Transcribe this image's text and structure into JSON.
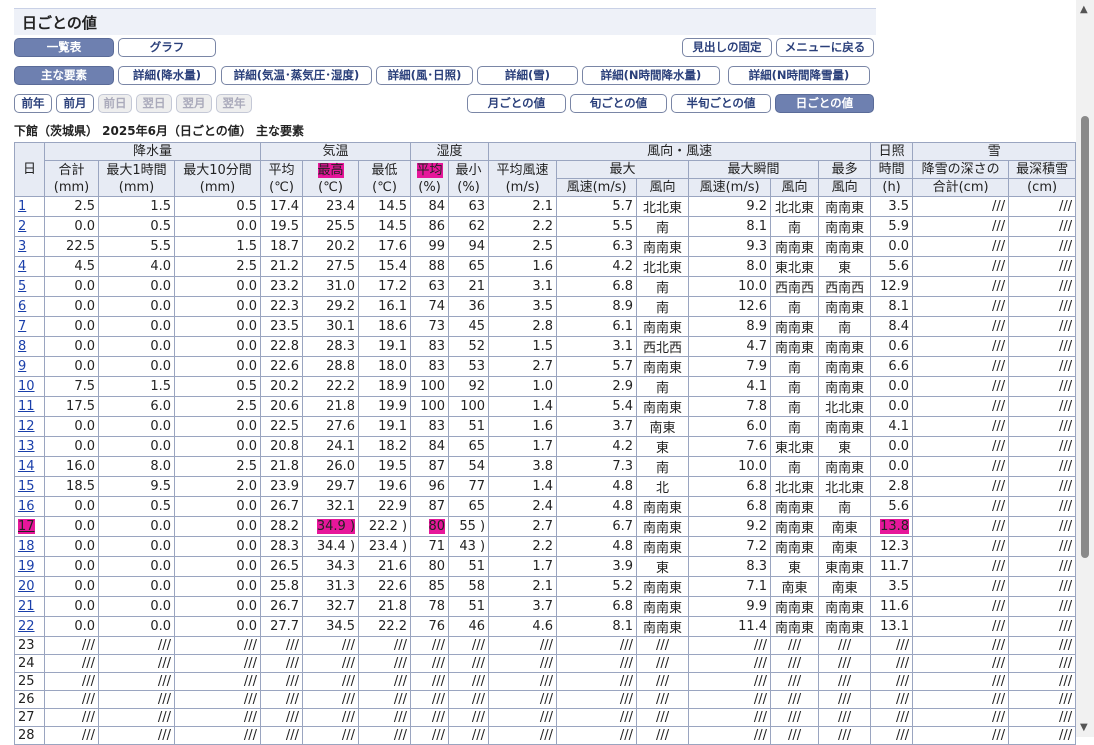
{
  "page_title": "日ごとの値",
  "buttons_row1": {
    "list": "一覧表",
    "graph": "グラフ",
    "fix_header": "見出しの固定",
    "back_menu": "メニューに戻る"
  },
  "tabs_row2": [
    "主な要素",
    "詳細(降水量)",
    "詳細(気温･蒸気圧･湿度)",
    "詳細(風･日照)",
    "詳細(雪)",
    "詳細(N時間降水量)",
    "詳細(N時間降雪量)"
  ],
  "nav_row3": {
    "prev_year": "前年",
    "prev_month": "前月",
    "prev_day": "前日",
    "next_day": "翌日",
    "next_month": "翌月",
    "next_year": "翌年"
  },
  "period_tabs": [
    "月ごとの値",
    "旬ごとの値",
    "半旬ごとの値",
    "日ごとの値"
  ],
  "caption": "下館（茨城県） 2025年6月（日ごとの値） 主な要素",
  "headers": {
    "day": "日",
    "precip": "降水量",
    "temp": "気温",
    "humidity": "湿度",
    "wind": "風向・風速",
    "sunshine": "日照",
    "snow": "雪",
    "total": "合計",
    "max1h": "最大1時間",
    "max10m": "最大10分間",
    "avg": "平均",
    "max": "最高",
    "min": "最低",
    "hum_avg": "平均",
    "hum_min": "最小",
    "wind_avg": "平均風速",
    "wind_max": "最大",
    "wind_gust": "最大瞬間",
    "wind_most": "最多",
    "sun_hours": "時間",
    "snowfall": "降雪の深さの",
    "snowfall2": "合計(cm)",
    "snow_depth": "最深積雪",
    "snow_depth_unit": "(cm)",
    "u_mm": "(mm)",
    "u_c": "(℃)",
    "u_pct": "(%)",
    "u_ms": "(m/s)",
    "speed_ms": "風速(m/s)",
    "dir": "風向",
    "u_h": "(h)"
  },
  "rows": [
    [
      "1",
      "2.5",
      "1.5",
      "0.5",
      "17.4",
      "23.4",
      "14.5",
      "84",
      "63",
      "2.1",
      "5.7",
      "北北東",
      "9.2",
      "北北東",
      "南南東",
      "3.5",
      "///",
      "///"
    ],
    [
      "2",
      "0.0",
      "0.5",
      "0.0",
      "19.5",
      "25.5",
      "14.5",
      "86",
      "62",
      "2.2",
      "5.5",
      "南",
      "8.1",
      "南",
      "南南東",
      "5.9",
      "///",
      "///"
    ],
    [
      "3",
      "22.5",
      "5.5",
      "1.5",
      "18.7",
      "20.2",
      "17.6",
      "99",
      "94",
      "2.5",
      "6.3",
      "南南東",
      "9.3",
      "南南東",
      "南南東",
      "0.0",
      "///",
      "///"
    ],
    [
      "4",
      "4.5",
      "4.0",
      "2.5",
      "21.2",
      "27.5",
      "15.4",
      "88",
      "65",
      "1.6",
      "4.2",
      "北北東",
      "8.0",
      "東北東",
      "東",
      "5.6",
      "///",
      "///"
    ],
    [
      "5",
      "0.0",
      "0.0",
      "0.0",
      "23.2",
      "31.0",
      "17.2",
      "63",
      "21",
      "3.1",
      "6.8",
      "南",
      "10.0",
      "西南西",
      "西南西",
      "12.9",
      "///",
      "///"
    ],
    [
      "6",
      "0.0",
      "0.0",
      "0.0",
      "22.3",
      "29.2",
      "16.1",
      "74",
      "36",
      "3.5",
      "8.9",
      "南",
      "12.6",
      "南",
      "南南東",
      "8.1",
      "///",
      "///"
    ],
    [
      "7",
      "0.0",
      "0.0",
      "0.0",
      "23.5",
      "30.1",
      "18.6",
      "73",
      "45",
      "2.8",
      "6.1",
      "南南東",
      "8.9",
      "南南東",
      "南",
      "8.4",
      "///",
      "///"
    ],
    [
      "8",
      "0.0",
      "0.0",
      "0.0",
      "22.8",
      "28.3",
      "19.1",
      "83",
      "52",
      "1.5",
      "3.1",
      "西北西",
      "4.7",
      "南南東",
      "南南東",
      "0.6",
      "///",
      "///"
    ],
    [
      "9",
      "0.0",
      "0.0",
      "0.0",
      "22.6",
      "28.8",
      "18.0",
      "83",
      "53",
      "2.7",
      "5.7",
      "南南東",
      "7.9",
      "南",
      "南南東",
      "6.6",
      "///",
      "///"
    ],
    [
      "10",
      "7.5",
      "1.5",
      "0.5",
      "20.2",
      "22.2",
      "18.9",
      "100",
      "92",
      "1.0",
      "2.9",
      "南",
      "4.1",
      "南",
      "南南東",
      "0.0",
      "///",
      "///"
    ],
    [
      "11",
      "17.5",
      "6.0",
      "2.5",
      "20.6",
      "21.8",
      "19.9",
      "100",
      "100",
      "1.4",
      "5.4",
      "南南東",
      "7.8",
      "南",
      "北北東",
      "0.0",
      "///",
      "///"
    ],
    [
      "12",
      "0.0",
      "0.0",
      "0.0",
      "22.5",
      "27.6",
      "19.1",
      "83",
      "51",
      "1.6",
      "3.7",
      "南東",
      "6.0",
      "南",
      "南南東",
      "4.1",
      "///",
      "///"
    ],
    [
      "13",
      "0.0",
      "0.0",
      "0.0",
      "20.8",
      "24.1",
      "18.2",
      "84",
      "65",
      "1.7",
      "4.2",
      "東",
      "7.6",
      "東北東",
      "東",
      "0.0",
      "///",
      "///"
    ],
    [
      "14",
      "16.0",
      "8.0",
      "2.5",
      "21.8",
      "26.0",
      "19.5",
      "87",
      "54",
      "3.8",
      "7.3",
      "南",
      "10.0",
      "南",
      "南南東",
      "0.0",
      "///",
      "///"
    ],
    [
      "15",
      "18.5",
      "9.5",
      "2.0",
      "23.9",
      "29.7",
      "19.6",
      "96",
      "77",
      "1.4",
      "4.8",
      "北",
      "6.8",
      "北北東",
      "北北東",
      "2.8",
      "///",
      "///"
    ],
    [
      "16",
      "0.0",
      "0.5",
      "0.0",
      "26.7",
      "32.1",
      "22.9",
      "87",
      "65",
      "2.4",
      "4.8",
      "南南東",
      "6.8",
      "南南東",
      "南",
      "5.6",
      "///",
      "///"
    ],
    [
      "17",
      "0.0",
      "0.0",
      "0.0",
      "28.2",
      "34.9 )",
      "22.2 )",
      "80",
      "55 )",
      "2.7",
      "6.7",
      "南南東",
      "9.2",
      "南南東",
      "南東",
      "13.8",
      "///",
      "///"
    ],
    [
      "18",
      "0.0",
      "0.0",
      "0.0",
      "28.3",
      "34.4 )",
      "23.4 )",
      "71",
      "43 )",
      "2.2",
      "4.8",
      "南南東",
      "7.2",
      "南南東",
      "南東",
      "12.3",
      "///",
      "///"
    ],
    [
      "19",
      "0.0",
      "0.0",
      "0.0",
      "26.5",
      "34.3",
      "21.6",
      "80",
      "51",
      "1.7",
      "3.9",
      "東",
      "8.3",
      "東",
      "東南東",
      "11.7",
      "///",
      "///"
    ],
    [
      "20",
      "0.0",
      "0.0",
      "0.0",
      "25.8",
      "31.3",
      "22.6",
      "85",
      "58",
      "2.1",
      "5.2",
      "南南東",
      "7.1",
      "南東",
      "南東",
      "3.5",
      "///",
      "///"
    ],
    [
      "21",
      "0.0",
      "0.0",
      "0.0",
      "26.7",
      "32.7",
      "21.8",
      "78",
      "51",
      "3.7",
      "6.8",
      "南南東",
      "9.9",
      "南南東",
      "南南東",
      "11.6",
      "///",
      "///"
    ],
    [
      "22",
      "0.0",
      "0.0",
      "0.0",
      "27.7",
      "34.5",
      "22.2",
      "76",
      "46",
      "4.6",
      "8.1",
      "南南東",
      "11.4",
      "南南東",
      "南南東",
      "13.1",
      "///",
      "///"
    ],
    [
      "23",
      "///",
      "///",
      "///",
      "///",
      "///",
      "///",
      "///",
      "///",
      "///",
      "///",
      "///",
      "///",
      "///",
      "///",
      "///",
      "///",
      "///"
    ],
    [
      "24",
      "///",
      "///",
      "///",
      "///",
      "///",
      "///",
      "///",
      "///",
      "///",
      "///",
      "///",
      "///",
      "///",
      "///",
      "///",
      "///",
      "///"
    ],
    [
      "25",
      "///",
      "///",
      "///",
      "///",
      "///",
      "///",
      "///",
      "///",
      "///",
      "///",
      "///",
      "///",
      "///",
      "///",
      "///",
      "///",
      "///"
    ],
    [
      "26",
      "///",
      "///",
      "///",
      "///",
      "///",
      "///",
      "///",
      "///",
      "///",
      "///",
      "///",
      "///",
      "///",
      "///",
      "///",
      "///",
      "///"
    ],
    [
      "27",
      "///",
      "///",
      "///",
      "///",
      "///",
      "///",
      "///",
      "///",
      "///",
      "///",
      "///",
      "///",
      "///",
      "///",
      "///",
      "///",
      "///"
    ],
    [
      "28",
      "///",
      "///",
      "///",
      "///",
      "///",
      "///",
      "///",
      "///",
      "///",
      "///",
      "///",
      "///",
      "///",
      "///",
      "///",
      "///",
      "///"
    ]
  ],
  "colors": {
    "accent": "#6e80b0",
    "highlight": "#e6169a",
    "link": "#1a3faa"
  },
  "icons": {
    "scroll_up": "▲",
    "scroll_down": "▼"
  }
}
